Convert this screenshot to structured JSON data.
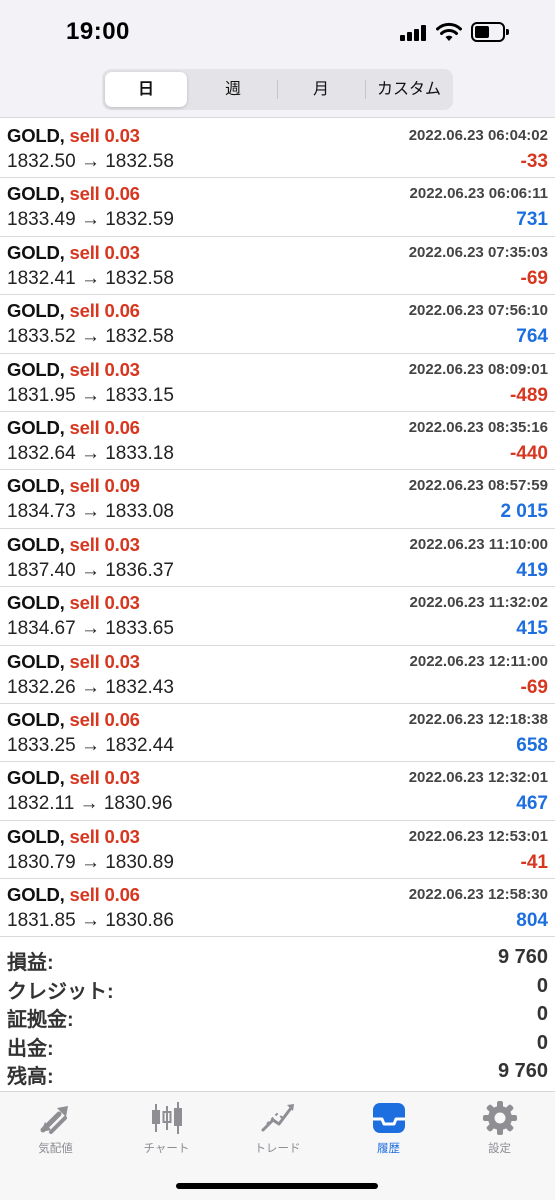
{
  "status_bar": {
    "time": "19:00"
  },
  "period_tabs": [
    {
      "label": "日",
      "active": true
    },
    {
      "label": "週",
      "active": false
    },
    {
      "label": "月",
      "active": false
    },
    {
      "label": "カスタム",
      "active": false
    }
  ],
  "deals": [
    {
      "symbol": "GOLD,",
      "type": "sell 0.03",
      "prices": "1832.50 → 1832.58",
      "time": "2022.06.23 06:04:02",
      "profit": "-33",
      "sign": "neg"
    },
    {
      "symbol": "GOLD,",
      "type": "sell 0.06",
      "prices": "1833.49 → 1832.59",
      "time": "2022.06.23 06:06:11",
      "profit": "731",
      "sign": "pos"
    },
    {
      "symbol": "GOLD,",
      "type": "sell 0.03",
      "prices": "1832.41 → 1832.58",
      "time": "2022.06.23 07:35:03",
      "profit": "-69",
      "sign": "neg"
    },
    {
      "symbol": "GOLD,",
      "type": "sell 0.06",
      "prices": "1833.52 → 1832.58",
      "time": "2022.06.23 07:56:10",
      "profit": "764",
      "sign": "pos"
    },
    {
      "symbol": "GOLD,",
      "type": "sell 0.03",
      "prices": "1831.95 → 1833.15",
      "time": "2022.06.23 08:09:01",
      "profit": "-489",
      "sign": "neg"
    },
    {
      "symbol": "GOLD,",
      "type": "sell 0.06",
      "prices": "1832.64 → 1833.18",
      "time": "2022.06.23 08:35:16",
      "profit": "-440",
      "sign": "neg"
    },
    {
      "symbol": "GOLD,",
      "type": "sell 0.09",
      "prices": "1834.73 → 1833.08",
      "time": "2022.06.23 08:57:59",
      "profit": "2 015",
      "sign": "pos"
    },
    {
      "symbol": "GOLD,",
      "type": "sell 0.03",
      "prices": "1837.40 → 1836.37",
      "time": "2022.06.23 11:10:00",
      "profit": "419",
      "sign": "pos"
    },
    {
      "symbol": "GOLD,",
      "type": "sell 0.03",
      "prices": "1834.67 → 1833.65",
      "time": "2022.06.23 11:32:02",
      "profit": "415",
      "sign": "pos"
    },
    {
      "symbol": "GOLD,",
      "type": "sell 0.03",
      "prices": "1832.26 → 1832.43",
      "time": "2022.06.23 12:11:00",
      "profit": "-69",
      "sign": "neg"
    },
    {
      "symbol": "GOLD,",
      "type": "sell 0.06",
      "prices": "1833.25 → 1832.44",
      "time": "2022.06.23 12:18:38",
      "profit": "658",
      "sign": "pos"
    },
    {
      "symbol": "GOLD,",
      "type": "sell 0.03",
      "prices": "1832.11 → 1830.96",
      "time": "2022.06.23 12:32:01",
      "profit": "467",
      "sign": "pos"
    },
    {
      "symbol": "GOLD,",
      "type": "sell 0.03",
      "prices": "1830.79 → 1830.89",
      "time": "2022.06.23 12:53:01",
      "profit": "-41",
      "sign": "neg"
    },
    {
      "symbol": "GOLD,",
      "type": "sell 0.06",
      "prices": "1831.85 → 1830.86",
      "time": "2022.06.23 12:58:30",
      "profit": "804",
      "sign": "pos"
    }
  ],
  "summary": [
    {
      "label": "損益:",
      "value": "9 760"
    },
    {
      "label": "クレジット:",
      "value": "0"
    },
    {
      "label": "証拠金:",
      "value": "0"
    },
    {
      "label": "出金:",
      "value": "0"
    },
    {
      "label": "残高:",
      "value": "9 760"
    }
  ],
  "tabbar": [
    {
      "label": "気配値",
      "icon": "quotes-arrows-icon",
      "active": false
    },
    {
      "label": "チャート",
      "icon": "candlestick-chart-icon",
      "active": false
    },
    {
      "label": "トレード",
      "icon": "trade-trend-icon",
      "active": false
    },
    {
      "label": "履歴",
      "icon": "history-inbox-icon",
      "active": true
    },
    {
      "label": "設定",
      "icon": "gear-icon",
      "active": false
    }
  ],
  "colors": {
    "loss": "#d7361f",
    "profit": "#1d6fe0",
    "active_tab": "#1d6fe0",
    "inactive_tab": "#8e8e93"
  }
}
